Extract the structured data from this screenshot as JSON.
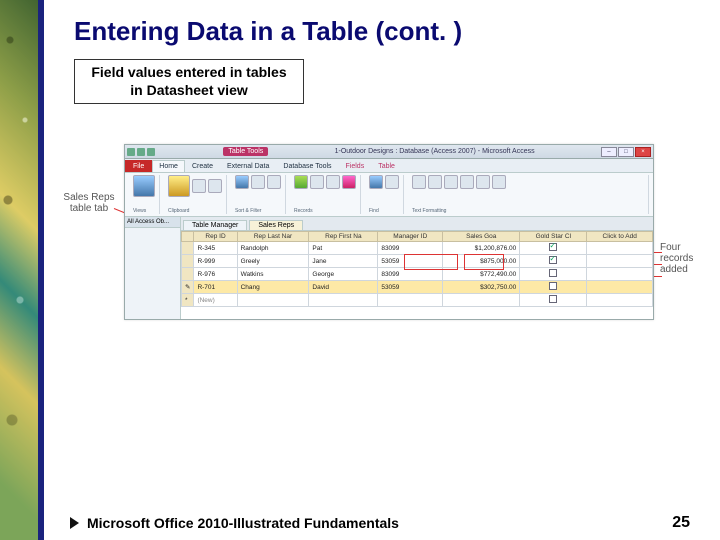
{
  "title": "Entering Data in a Table (cont. )",
  "callout": {
    "line1": "Field values entered in tables",
    "line2": "in Datasheet view"
  },
  "annotations": {
    "left": "Sales Reps\ntable tab",
    "right": "Four\nrecords\nadded"
  },
  "access_window": {
    "title_text": "1-Outdoor Designs : Database (Access 2007) - Microsoft Access",
    "context_tab": "Table Tools",
    "ribbon_tabs": [
      "File",
      "Home",
      "Create",
      "External Data",
      "Database Tools",
      "Fields",
      "Table"
    ],
    "doc_tabs": [
      "Table Manager",
      "Sales Reps"
    ],
    "nav_header": "All Access Ob...",
    "columns": [
      "Rep ID",
      "Rep Last Nar",
      "Rep First Na",
      "Manager ID",
      "Sales Goa",
      "Gold Star Cl",
      "Click to Add"
    ],
    "rows": [
      {
        "rep_id": "R-345",
        "last": "Randolph",
        "first": "Pat",
        "mgr": "83099",
        "goal": "$1,200,876.00",
        "gold": true
      },
      {
        "rep_id": "R-999",
        "last": "Greely",
        "first": "Jane",
        "mgr": "53059",
        "goal": "$875,000.00",
        "gold": true
      },
      {
        "rep_id": "R-976",
        "last": "Watkins",
        "first": "George",
        "mgr": "83099",
        "goal": "$772,490.00",
        "gold": false
      },
      {
        "rep_id": "R-701",
        "last": "Chang",
        "first": "David",
        "mgr": "53059",
        "goal": "$302,750.00",
        "gold": false
      }
    ],
    "new_row_placeholder": "(New)"
  },
  "footer": {
    "text": "Microsoft Office 2010-Illustrated Fundamentals",
    "page": "25"
  }
}
